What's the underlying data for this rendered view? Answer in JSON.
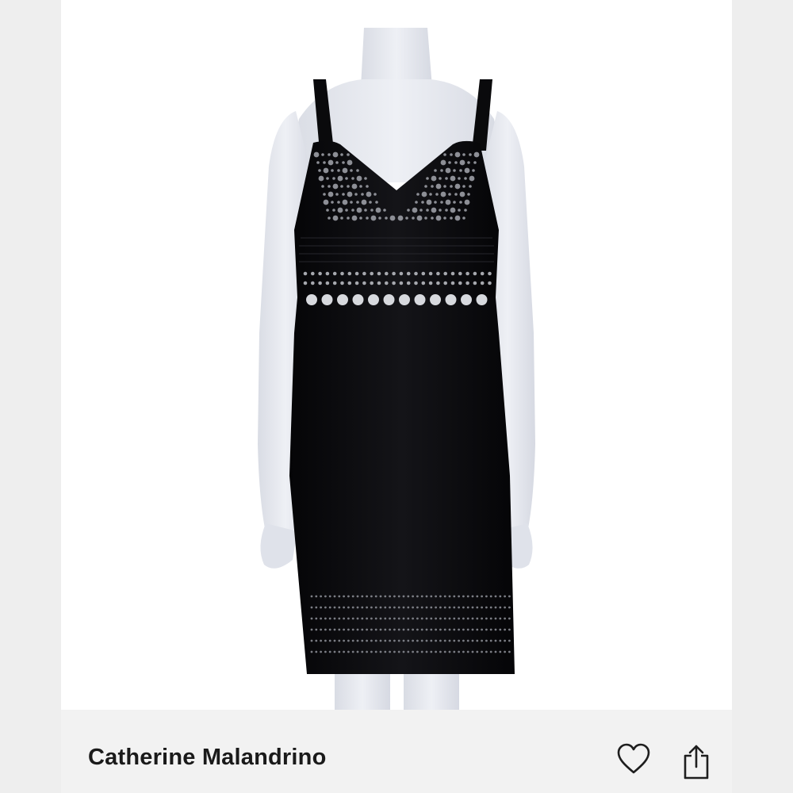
{
  "product": {
    "brand": "Catherine Malandrino",
    "image": "black studded sleeveless dress on mannequin",
    "colors": {
      "page_bg": "#eeeeee",
      "photo_bg": "#ffffff",
      "info_bg": "#f2f2f2",
      "dress": "#0d0d0f",
      "mannequin": "#e6e8ee"
    }
  },
  "actions": {
    "favorite_icon": "heart-icon",
    "share_icon": "share-icon"
  }
}
